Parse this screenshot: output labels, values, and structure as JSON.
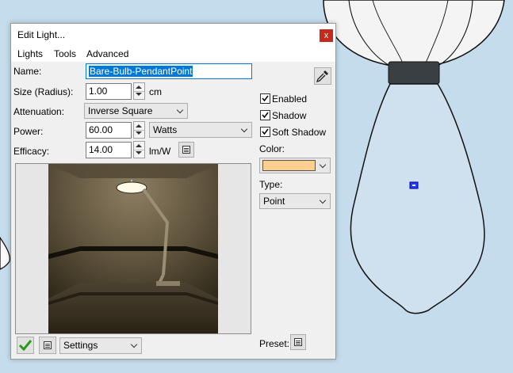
{
  "dialog": {
    "title": "Edit Light...",
    "close_label": "x",
    "menu": [
      "Lights",
      "Tools",
      "Advanced"
    ]
  },
  "form": {
    "name_label": "Name:",
    "name_value": "Bare-Bulb-PendantPoint",
    "size_label": "Size (Radius):",
    "size_value": "1.00",
    "size_unit": "cm",
    "attenuation_label": "Attenuation:",
    "attenuation_value": "Inverse Square",
    "power_label": "Power:",
    "power_value": "60.00",
    "power_unit": "Watts",
    "efficacy_label": "Efficacy:",
    "efficacy_value": "14.00",
    "efficacy_unit": "lm/W"
  },
  "options": {
    "enabled_label": "Enabled",
    "enabled": true,
    "shadow_label": "Shadow",
    "shadow": true,
    "soft_shadow_label": "Soft Shadow",
    "soft_shadow": true,
    "color_label": "Color:",
    "color_value": "#fccf8f",
    "type_label": "Type:",
    "type_value": "Point"
  },
  "footer": {
    "settings_value": "Settings",
    "preset_label": "Preset:"
  },
  "icons": {
    "eyedropper": "eyedropper-icon",
    "checkmark": "checkmark-icon",
    "document": "document-icon",
    "close": "close-icon"
  }
}
